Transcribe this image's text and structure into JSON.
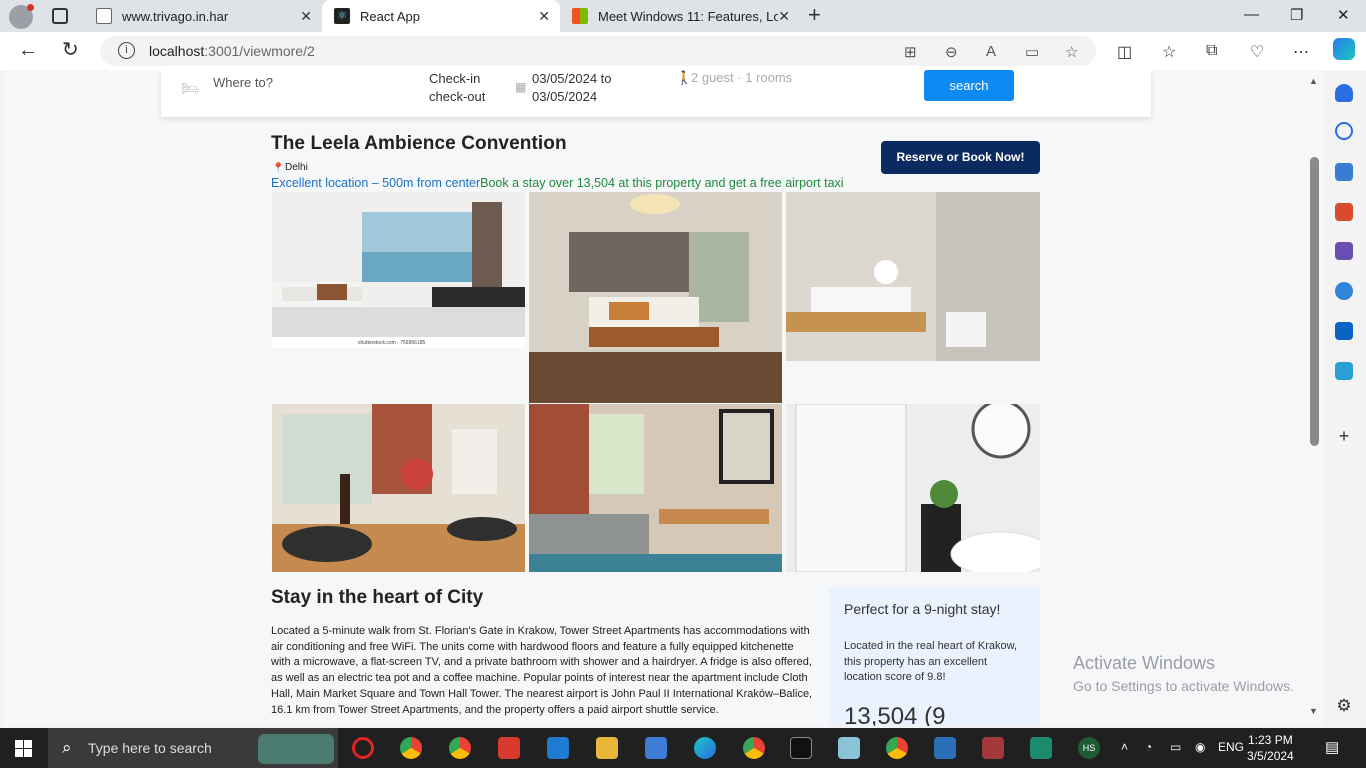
{
  "browser": {
    "tabs": [
      {
        "title": "www.trivago.in.har",
        "active": false
      },
      {
        "title": "React App",
        "active": true
      },
      {
        "title": "Meet Windows 11: Features, Look",
        "active": false
      }
    ],
    "address": {
      "host": "localhost",
      "path": ":3001/viewmore/2"
    }
  },
  "search_bar": {
    "where_placeholder": "Where to?",
    "check_in_label": "Check-in",
    "check_out_label": "check-out",
    "date_from": "03/05/2024 to",
    "date_to": "03/05/2024",
    "guests": "2 guest · 1 rooms",
    "search_label": "search"
  },
  "hotel": {
    "name": "The Leela Ambience Convention",
    "city": "Delhi",
    "location_note": "Excellent location – 500m from center",
    "offer_note": "Book a stay over 13,504 at this property and get a free airport taxi",
    "reserve_label": "Reserve or Book Now!",
    "photo_caption": "shutterstock.com · 756956185"
  },
  "details": {
    "title": "Stay in the heart of City",
    "description": "Located a 5-minute walk from St. Florian's Gate in Krakow, Tower Street Apartments has accommodations with air conditioning and free WiFi. The units come with hardwood floors and feature a fully equipped kitchenette with a microwave, a flat-screen TV, and a private bathroom with shower and a hairdryer. A fridge is also offered, as well as an electric tea pot and a coffee machine. Popular points of interest near the apartment include Cloth Hall, Main Market Square and Town Hall Tower. The nearest airport is John Paul II International Kraków–Balice, 16.1 km from Tower Street Apartments, and the property offers a paid airport shuttle service.",
    "box_title": "Perfect for a 9-night stay!",
    "box_text": "Located in the real heart of Krakow, this property has an excellent location score of 9.8!",
    "box_price": "13,504 (9"
  },
  "watermark": {
    "line1": "Activate Windows",
    "line2": "Go to Settings to activate Windows."
  },
  "taskbar": {
    "search_placeholder": "Type here to search",
    "lang": "ENG",
    "time": "1:23 PM",
    "date": "3/5/2024"
  }
}
